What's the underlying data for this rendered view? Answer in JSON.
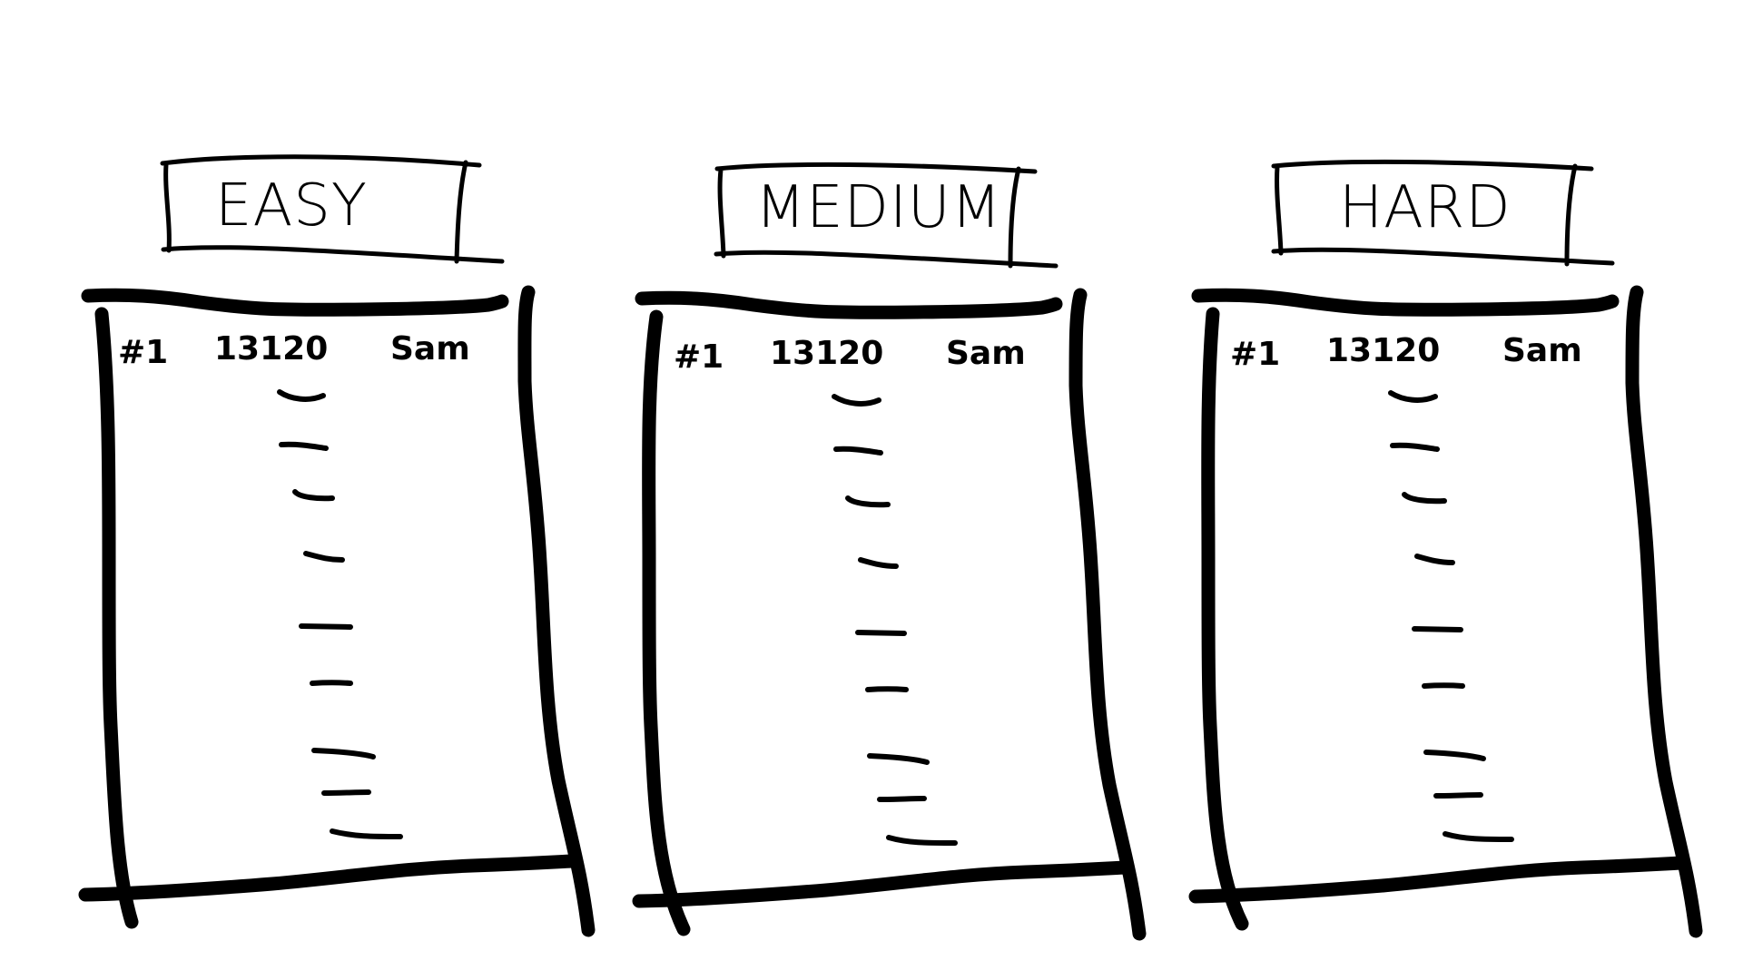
{
  "boards": [
    {
      "title": "EASY",
      "top_entry": {
        "rank": "#1",
        "score": "13120",
        "name": "Sam"
      },
      "placeholder_rows": 9
    },
    {
      "title": "MEDIUM",
      "top_entry": {
        "rank": "#1",
        "score": "13120",
        "name": "Sam"
      },
      "placeholder_rows": 9
    },
    {
      "title": "HARD",
      "top_entry": {
        "rank": "#1",
        "score": "13120",
        "name": "Sam"
      },
      "placeholder_rows": 9
    }
  ]
}
